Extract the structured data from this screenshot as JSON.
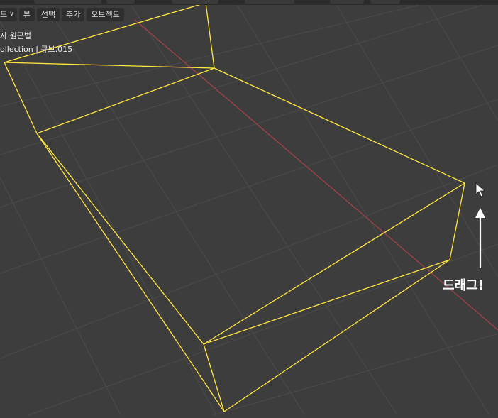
{
  "header": {
    "mode_label": "드",
    "menu": [
      "뷰",
      "선택",
      "추가",
      "오브젝트"
    ]
  },
  "overlay": {
    "view_name": "자 원근법",
    "collection_info": "ollection | 큐브.015"
  },
  "annotation": {
    "drag_text": "드래그!"
  },
  "colors": {
    "background": "#3d3d3d",
    "grid": "#4a4a4a",
    "x_axis": "#a2414b",
    "selection_outline": "#ffe640",
    "annotation": "#ffffff"
  },
  "icons": [
    "mouse-cursor-icon",
    "arrow-up-icon",
    "chevron-down-icon"
  ]
}
